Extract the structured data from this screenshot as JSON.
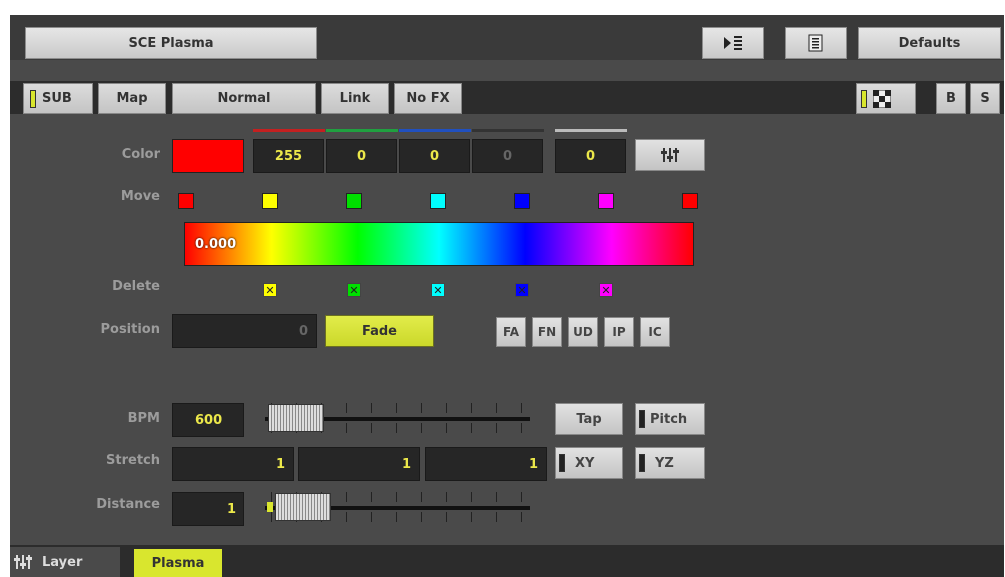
{
  "header": {
    "effect_name": "SCE Plasma",
    "defaults_label": "Defaults"
  },
  "toolbar": {
    "sub_label": "SUB",
    "map_label": "Map",
    "blend_mode": "Normal",
    "link_label": "Link",
    "nofx_label": "No FX",
    "b_label": "B",
    "s_label": "S"
  },
  "color": {
    "label": "Color",
    "swatch": "#ff0000",
    "r": "255",
    "g": "0",
    "b": "0",
    "w": "0",
    "a": "0"
  },
  "move": {
    "label": "Move",
    "colors": [
      "#ff0000",
      "#ffff00",
      "#00e000",
      "#00ffff",
      "#0000ff",
      "#ff00ff",
      "#ff0000"
    ]
  },
  "gradient": {
    "value": "0.000"
  },
  "delete": {
    "label": "Delete",
    "colors": [
      "#ffff00",
      "#00e000",
      "#00ffff",
      "#0000ff",
      "#ff00ff"
    ]
  },
  "position": {
    "label": "Position",
    "value": "0",
    "fade_label": "Fade",
    "buttons": [
      "FA",
      "FN",
      "UD",
      "IP",
      "IC"
    ]
  },
  "bpm": {
    "label": "BPM",
    "value": "600",
    "tap_label": "Tap",
    "pitch_label": "Pitch"
  },
  "stretch": {
    "label": "Stretch",
    "x": "1",
    "y": "1",
    "z": "1",
    "xy_label": "XY",
    "yz_label": "YZ"
  },
  "distance": {
    "label": "Distance",
    "value": "1"
  },
  "tabs": {
    "layer": "Layer",
    "plasma": "Plasma"
  },
  "colors": {
    "accent": "#d9e62e",
    "panel": "#4a4a4a"
  }
}
